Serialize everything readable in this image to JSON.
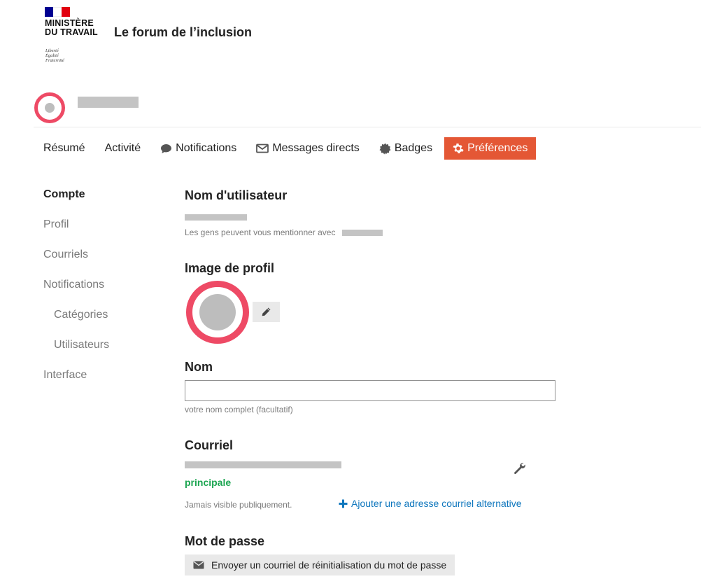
{
  "header": {
    "ministry_line1": "MINISTÈRE",
    "ministry_line2": "DU TRAVAIL",
    "motto": [
      "Liberté",
      "Égalité",
      "Fraternité"
    ],
    "site_title": "Le forum de l’inclusion",
    "flag_colors": [
      "#000091",
      "#ffffff",
      "#e1000f"
    ]
  },
  "nav": {
    "tabs": [
      {
        "label": "Résumé",
        "icon": null
      },
      {
        "label": "Activité",
        "icon": null
      },
      {
        "label": "Notifications",
        "icon": "comment-icon"
      },
      {
        "label": "Messages directs",
        "icon": "envelope-icon"
      },
      {
        "label": "Badges",
        "icon": "certificate-icon"
      },
      {
        "label": "Préférences",
        "icon": "gear-icon",
        "active": true
      }
    ],
    "active_color": "#e45735"
  },
  "sidebar": {
    "items": [
      {
        "label": "Compte",
        "active": true
      },
      {
        "label": "Profil"
      },
      {
        "label": "Courriels"
      },
      {
        "label": "Notifications"
      },
      {
        "label": "Catégories",
        "sub": true
      },
      {
        "label": "Utilisateurs",
        "sub": true
      },
      {
        "label": "Interface"
      }
    ]
  },
  "account": {
    "username_title": "Nom d'utilisateur",
    "mention_hint": "Les gens peuvent vous mentionner avec",
    "profile_image_title": "Image de profil",
    "name_title": "Nom",
    "name_value": "",
    "name_hint": "votre nom complet (facultatif)",
    "email_title": "Courriel",
    "email_primary_label": "principale",
    "email_visibility_hint": "Jamais visible publiquement.",
    "add_email_label": "Ajouter une adresse courriel alternative",
    "password_title": "Mot de passe",
    "reset_password_label": "Envoyer un courriel de réinitialisation du mot de passe"
  },
  "colors": {
    "avatar_ring": "#ee4a65",
    "link": "#0e76bd",
    "primary_green": "#1ca551"
  }
}
